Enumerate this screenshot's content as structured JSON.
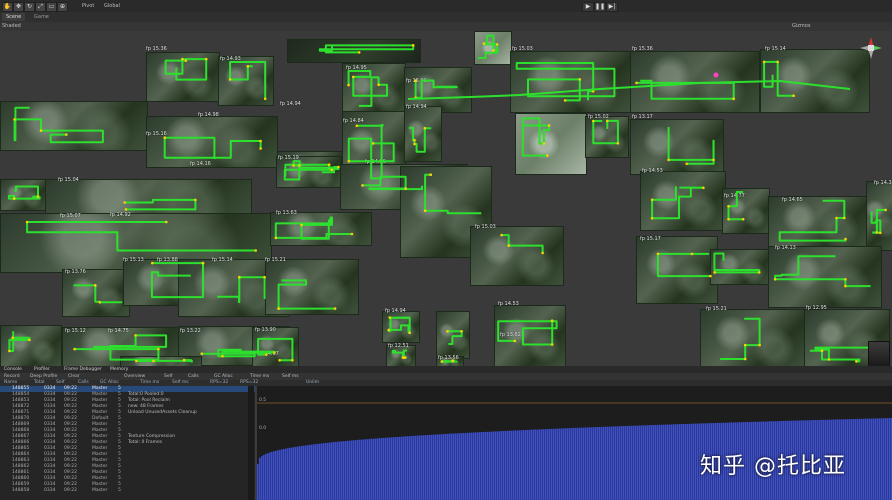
{
  "toolbar": {
    "pivot_label": "Pivot",
    "global_label": "Global",
    "play_icon": "play-icon",
    "pause_icon": "pause-icon",
    "step_icon": "step-icon"
  },
  "tabs": {
    "scene": "Scene",
    "game": "Game"
  },
  "scene_bar": {
    "shading": "Shaded",
    "gizmos": "Gizmos"
  },
  "scene_labels": [
    "fp 15.36",
    "fp 14.93",
    "fp 14.95",
    "fp 15.06",
    "fp 15.03",
    "fp 15.36",
    "fp 15.14",
    "fp 14.98",
    "fp 14.94",
    "fp 14.94",
    "fp 15.16",
    "fp 14.84",
    "fp 15.02",
    "fp 13.17",
    "fp 14.16",
    "fp 15.19",
    "fp 14.96",
    "fp 15.04",
    "fp 14.53",
    "fp 15.07",
    "fp 14.92",
    "fp 13.63",
    "fp 15.03",
    "fp 14.77",
    "fp 14.65",
    "fp 14.38",
    "fp 15.17",
    "fp 14.13",
    "fp 13.76",
    "fp 15.13",
    "fp 13.88",
    "fp 15.14",
    "fp 15.21",
    "fp 14.53",
    "fp 14.94",
    "fp 13.82",
    "fp 15.12",
    "fp 14.75",
    "fp 13.22",
    "fp 13.90",
    "fp 14.97",
    "fp 12.51",
    "fp 13.56",
    "fp 15.21",
    "fp 12.95"
  ],
  "bottom_tabs": [
    "Console",
    "Profiler",
    "Frame Debugger",
    "Memory"
  ],
  "profiler_bar": {
    "record": "Record",
    "deep": "Deep Profile",
    "clear": "Clear",
    "columns": [
      "Overview",
      "Self",
      "Calls",
      "GC Alloc",
      "Time ms",
      "Self ms"
    ]
  },
  "list_header": [
    "Name",
    "Total",
    "Self",
    "Calls",
    "GC Alloc",
    "Time ms",
    "Self ms",
    "RPS=32",
    "RPS=32",
    "Unlim"
  ],
  "rows": [
    {
      "id": "148855",
      "n": "0334",
      "t": "09:22",
      "v": "Master",
      "c": "5"
    },
    {
      "id": "148854",
      "n": "0334",
      "t": "09:22",
      "v": "Master",
      "c": "5"
    },
    {
      "id": "148853",
      "n": "0334",
      "t": "09:22",
      "v": "Master",
      "c": "5"
    },
    {
      "id": "148872",
      "n": "0334",
      "t": "09:22",
      "v": "Master",
      "c": "5"
    },
    {
      "id": "148871",
      "n": "0334",
      "t": "09:22",
      "v": "Master",
      "c": "5"
    },
    {
      "id": "148870",
      "n": "0334",
      "t": "09:22",
      "v": "Default",
      "c": "5"
    },
    {
      "id": "148869",
      "n": "0334",
      "t": "09:22",
      "v": "Master",
      "c": "5"
    },
    {
      "id": "148868",
      "n": "0334",
      "t": "09:22",
      "v": "Master",
      "c": "5"
    },
    {
      "id": "148867",
      "n": "0334",
      "t": "09:22",
      "v": "Master",
      "c": "5"
    },
    {
      "id": "148866",
      "n": "0334",
      "t": "09:22",
      "v": "Master",
      "c": "5"
    },
    {
      "id": "148865",
      "n": "0334",
      "t": "09:22",
      "v": "Master",
      "c": "5"
    },
    {
      "id": "148864",
      "n": "0334",
      "t": "09:22",
      "v": "Master",
      "c": "5"
    },
    {
      "id": "148863",
      "n": "0334",
      "t": "09:22",
      "v": "Master",
      "c": "5"
    },
    {
      "id": "148862",
      "n": "0334",
      "t": "09:22",
      "v": "Master",
      "c": "5"
    },
    {
      "id": "148861",
      "n": "0334",
      "t": "09:22",
      "v": "Master",
      "c": "5"
    },
    {
      "id": "148860",
      "n": "0334",
      "t": "09:22",
      "v": "Master",
      "c": "5"
    },
    {
      "id": "148859",
      "n": "0334",
      "t": "09:22",
      "v": "Master",
      "c": "5"
    },
    {
      "id": "148858",
      "n": "0334",
      "t": "09:22",
      "v": "Master",
      "c": "5"
    }
  ],
  "detail_lines": [
    "Total:0 Pooled:0",
    "Total: Pool Reclaim",
    "new: 48 Frames",
    "Unload UnusedAssets Cleanup",
    "Texture Compression",
    "Total: 0 Frames"
  ],
  "graph": {
    "marker_top": "0.5",
    "marker_bottom": "0.0",
    "bar_color": "#3c4fd0"
  },
  "watermark": "知乎 @托比亚",
  "colors": {
    "route": "#2ee02e",
    "route_dots": "#f5d400",
    "accent_pink": "#ff40c0"
  }
}
